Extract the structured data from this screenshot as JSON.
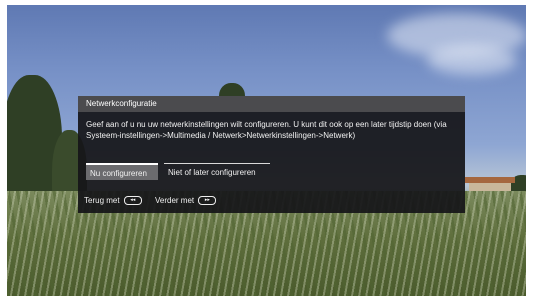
{
  "dialog": {
    "title": "Netwerkconfiguratie",
    "message": "Geef aan of u nu uw netwerkinstellingen wilt configureren. U kunt dit ook op een later tijdstip doen (via Systeem-instellingen->Multimedia / Netwerk>Netwerkinstellingen->Netwerk)",
    "buttons": [
      {
        "label": "Nu configureren",
        "state": "selected"
      },
      {
        "label": "Niet of later configureren",
        "state": "normal"
      }
    ]
  },
  "footer": {
    "back_label": "Terug met",
    "back_key_icon": "rewind-key-icon",
    "next_label": "Verder met",
    "next_key_icon": "forward-key-icon"
  }
}
